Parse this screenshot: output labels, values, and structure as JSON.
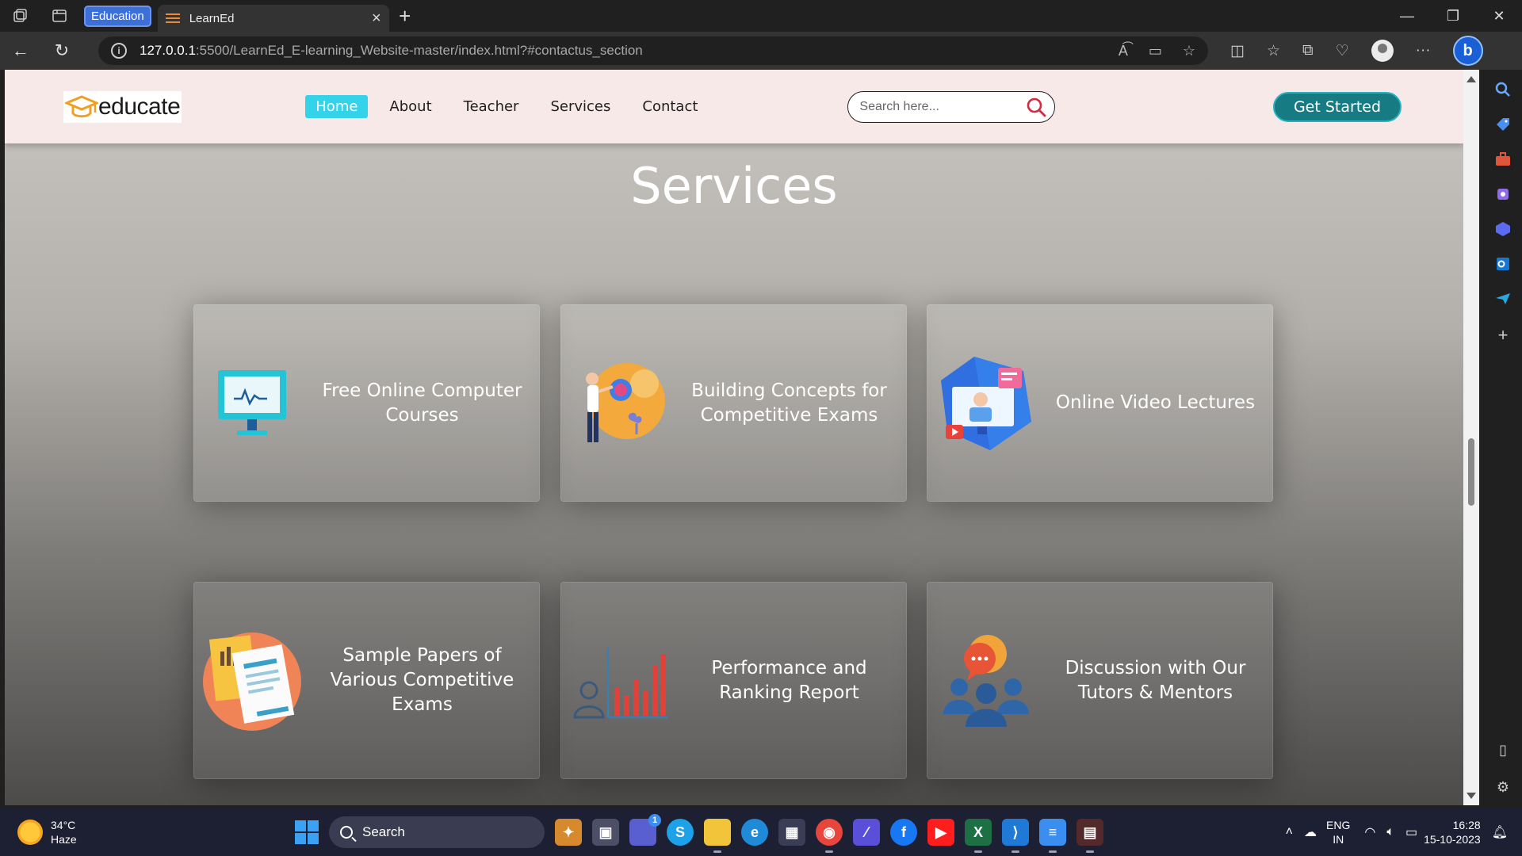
{
  "browser": {
    "workspace": "Education",
    "tab_title": "LearnEd",
    "url_host": "127.0.0.1",
    "url_path": ":5500/LearnEd_E-learning_Website-master/index.html?#contactus_section"
  },
  "site": {
    "logo_text": "educate",
    "nav": [
      "Home",
      "About",
      "Teacher",
      "Services",
      "Contact"
    ],
    "search_placeholder": "Search here...",
    "cta": "Get Started",
    "section_title": "Services",
    "cards": [
      {
        "label": "Free Online Computer Courses",
        "icon": "computer-monitor-icon"
      },
      {
        "label": "Building Concepts for Competitive Exams",
        "icon": "concept-brain-icon"
      },
      {
        "label": "Online Video Lectures",
        "icon": "video-lecture-icon"
      },
      {
        "label": "Sample Papers of Various Competitive Exams",
        "icon": "sample-papers-icon"
      },
      {
        "label": "Performance and Ranking Report",
        "icon": "bar-chart-icon"
      },
      {
        "label": "Discussion with Our Tutors & Mentors",
        "icon": "discussion-group-icon"
      }
    ],
    "accent": "#33d3ea",
    "cta_color": "#177b84"
  },
  "taskbar": {
    "temperature": "34°C",
    "weather": "Haze",
    "search_label": "Search",
    "teams_badge": "1",
    "lang_top": "ENG",
    "lang_bottom": "IN",
    "time": "16:28",
    "date": "15-10-2023"
  }
}
